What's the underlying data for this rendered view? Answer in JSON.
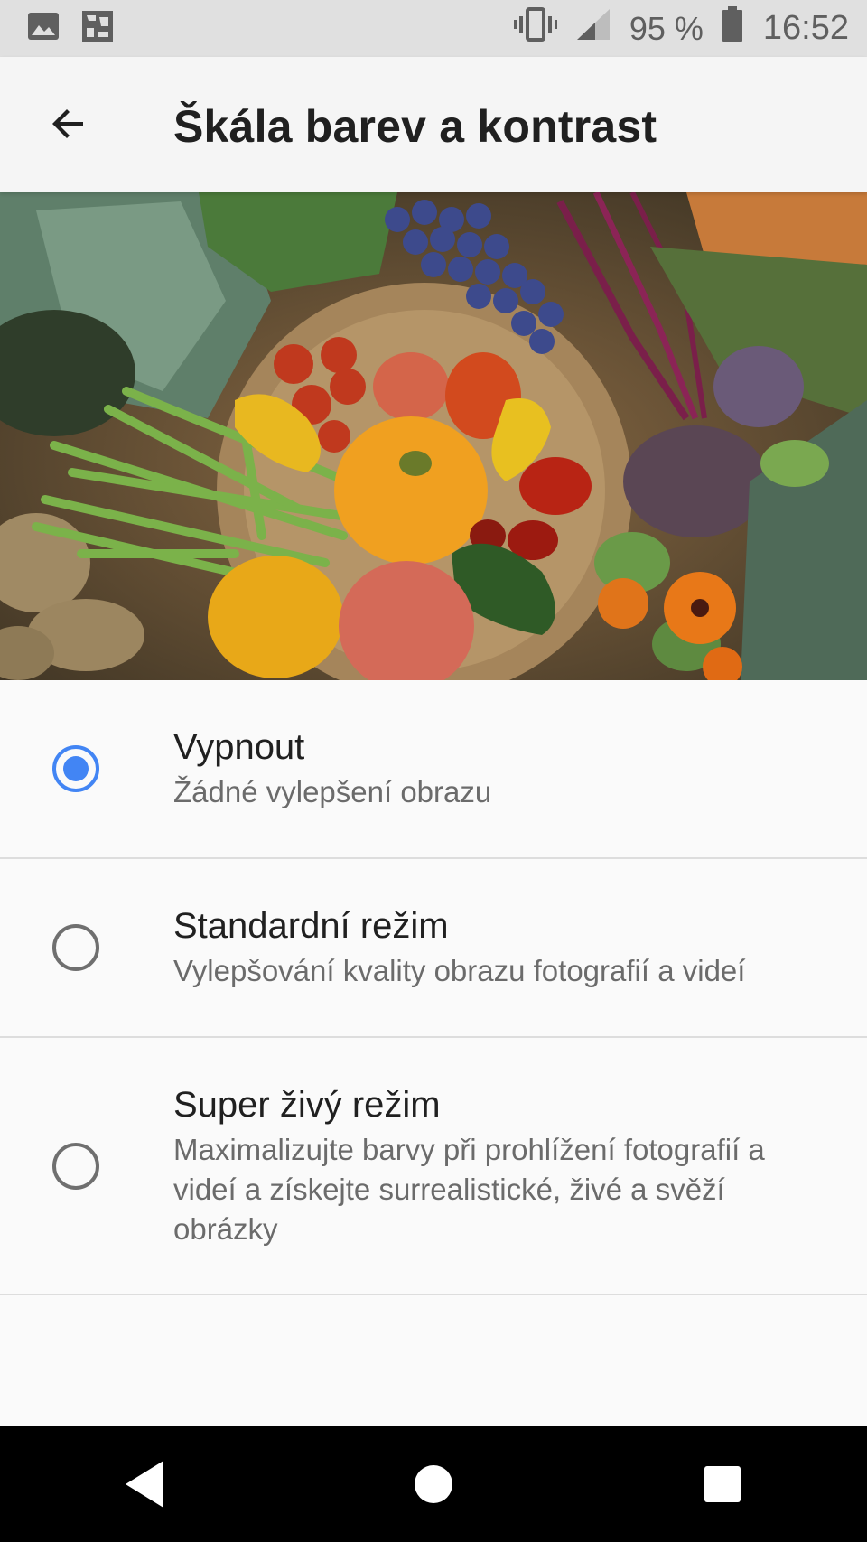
{
  "status_bar": {
    "battery_percent": "95 %",
    "time": "16:52",
    "icons": [
      "image-notification-icon",
      "app-notification-icon",
      "vibrate-icon",
      "signal-icon",
      "battery-icon"
    ]
  },
  "app_bar": {
    "title": "Škála barev a kontrast",
    "back_icon": "arrow-back-icon"
  },
  "hero": {
    "description_icon": "vegetables-photo"
  },
  "options": [
    {
      "title": "Vypnout",
      "description": "Žádné vylepšení obrazu",
      "selected": true
    },
    {
      "title": "Standardní režim",
      "description": "Vylepšování kvality obrazu fotografií a videí",
      "selected": false
    },
    {
      "title": "Super živý režim",
      "description": "Maximalizujte barvy při prohlížení fotografií a videí a získejte surrealistické, živé a svěží obrázky",
      "selected": false
    }
  ],
  "colors": {
    "accent": "#4285f4",
    "title_text": "#202020",
    "secondary_text": "#6b6b6b",
    "nav_bar": "#000000"
  },
  "nav_bar": {
    "icons": [
      "nav-back-icon",
      "nav-home-icon",
      "nav-recents-icon"
    ]
  }
}
